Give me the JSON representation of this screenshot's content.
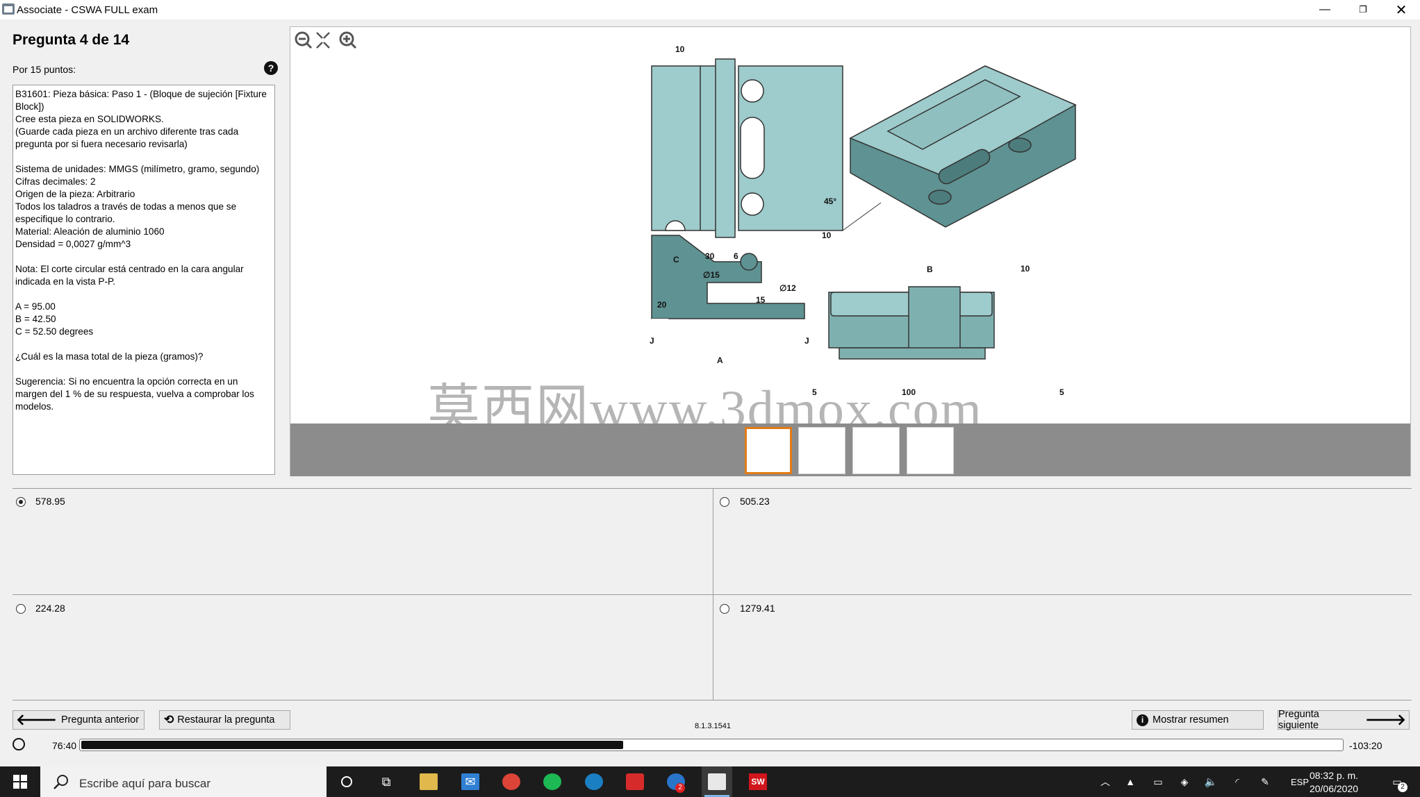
{
  "window": {
    "title": "Associate - CSWA FULL exam"
  },
  "question": {
    "title": "Pregunta 4 de 14",
    "points": "Por 15 puntos:",
    "paragraphs": [
      "B31601:  Pieza básica: Paso 1 - (Bloque de sujeción [Fixture Block])\nCree esta pieza en SOLIDWORKS.\n(Guarde cada pieza en un archivo diferente tras cada pregunta por si fuera necesario revisarla)",
      "Sistema de unidades: MMGS (milímetro, gramo, segundo)\nCifras decimales: 2\nOrigen de la pieza: Arbitrario\nTodos los taladros a través de todas a menos que se especifique lo contrario.\nMaterial: Aleación de aluminio 1060\nDensidad = 0,0027 g/mm^3",
      "Nota: El corte circular está centrado en la cara angular indicada en la vista P-P.",
      "A = 95.00\nB = 42.50\nC = 52.50 degrees",
      "¿Cuál es la masa total de la pieza (gramos)?",
      "Sugerencia: Si no encuentra la opción correcta en un margen del 1 % de su respuesta, vuelva a comprobar los modelos."
    ]
  },
  "drawing": {
    "dims": {
      "top_10": "10",
      "angle": "45°",
      "right_10": "10",
      "c_label": "C",
      "d30": "30",
      "d6": "6",
      "dia15": "∅15",
      "dia12": "∅12",
      "d15": "15",
      "d20": "20",
      "section_j1": "J",
      "section_j2": "J",
      "a_label": "A",
      "b_label": "B",
      "b10": "10",
      "d5_left": "5",
      "d100": "100",
      "d5_right": "5"
    },
    "watermark": "莫西网www.3dmox.com"
  },
  "answers": [
    {
      "label": "578.95",
      "selected": true
    },
    {
      "label": "505.23",
      "selected": false
    },
    {
      "label": "224.28",
      "selected": false
    },
    {
      "label": "1279.41",
      "selected": false
    }
  ],
  "nav": {
    "prev": "Pregunta anterior",
    "restore": "Restaurar la pregunta",
    "summary": "Mostrar resumen",
    "next": "Pregunta siguiente",
    "version": "8.1.3.1541"
  },
  "timer": {
    "elapsed": "76:40",
    "remaining": "-103:20",
    "progress": 0.43
  },
  "taskbar": {
    "search_placeholder": "Escribe aquí para buscar",
    "lang": "ESP",
    "time": "08:32 p. m.",
    "date": "20/06/2020",
    "edge_badge": "2",
    "notif_badge": "2",
    "sw_label": "SW"
  },
  "colors": {
    "part": "#9ecbcb",
    "part_dark": "#5f9292",
    "selected_thumb": "#e37b14"
  }
}
